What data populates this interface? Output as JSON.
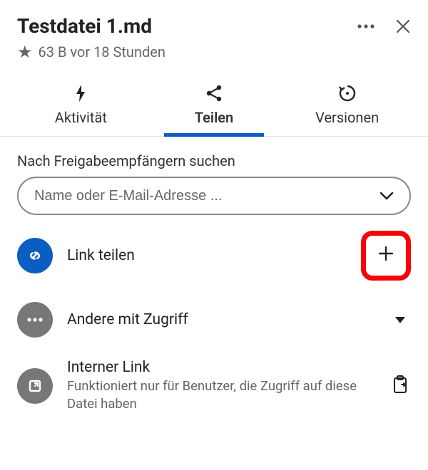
{
  "header": {
    "title": "Testdatei 1.md"
  },
  "meta": {
    "text": "63 B vor 18 Stunden"
  },
  "tabs": {
    "activity": "Aktivität",
    "share": "Teilen",
    "versions": "Versionen"
  },
  "share": {
    "search_label": "Nach Freigabeempfängern suchen",
    "search_placeholder": "Name oder E-Mail-Adresse ...",
    "link_share_label": "Link teilen",
    "others_label": "Andere mit Zugriff",
    "internal_link_title": "Interner Link",
    "internal_link_sub": "Funktioniert nur für Benutzer, die Zugriff auf diese Datei haben"
  }
}
